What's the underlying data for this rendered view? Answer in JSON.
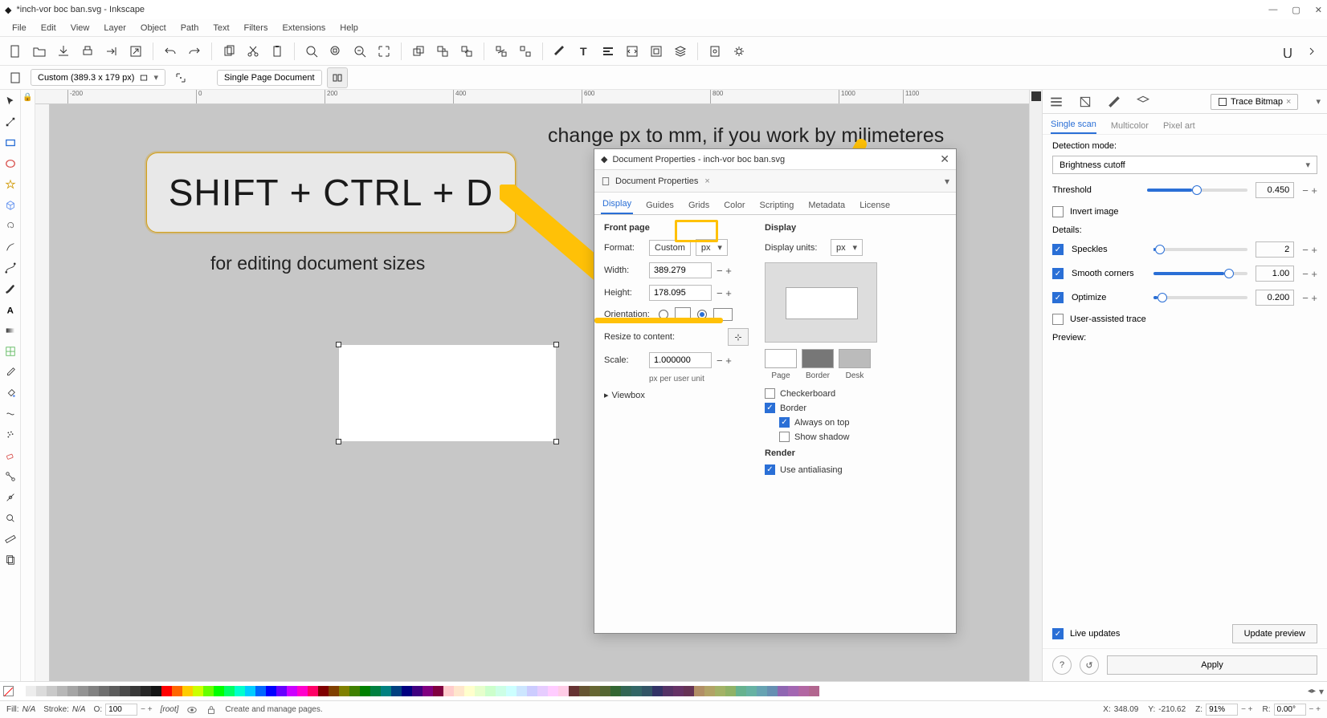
{
  "window": {
    "title": "*inch-vor boc ban.svg - Inkscape"
  },
  "menu": [
    "File",
    "Edit",
    "View",
    "Layer",
    "Object",
    "Path",
    "Text",
    "Filters",
    "Extensions",
    "Help"
  ],
  "doc_info": {
    "dimensions": "Custom (389.3 x 179 px)",
    "mode": "Single Page Document"
  },
  "annotations": {
    "shortcut": "SHIFT + CTRL + D",
    "subtitle": "for editing document sizes",
    "top_note": "change px to mm, if you work by milimeteres"
  },
  "dialog": {
    "title": "Document Properties - inch-vor boc ban.svg",
    "inner_tab": "Document Properties",
    "tabs": [
      "Display",
      "Guides",
      "Grids",
      "Color",
      "Scripting",
      "Metadata",
      "License"
    ],
    "active_tab": "Display",
    "front_page": {
      "heading": "Front page",
      "format_label": "Format:",
      "format_value": "Custom",
      "unit": "px",
      "width_label": "Width:",
      "width_value": "389.279",
      "height_label": "Height:",
      "height_value": "178.095",
      "orientation_label": "Orientation:",
      "resize_label": "Resize to content:",
      "scale_label": "Scale:",
      "scale_value": "1.000000",
      "scale_hint": "px per user unit",
      "viewbox_label": "Viewbox"
    },
    "display": {
      "heading": "Display",
      "units_label": "Display units:",
      "units_value": "px",
      "swatch_labels": [
        "Page",
        "Border",
        "Desk"
      ],
      "checkerboard": "Checkerboard",
      "border": "Border",
      "always_on_top": "Always on top",
      "show_shadow": "Show shadow",
      "render_heading": "Render",
      "antialiasing": "Use antialiasing"
    }
  },
  "trace_panel": {
    "tab_label": "Trace Bitmap",
    "sub_tabs": [
      "Single scan",
      "Multicolor",
      "Pixel art"
    ],
    "active_sub": "Single scan",
    "detection_label": "Detection mode:",
    "detection_value": "Brightness cutoff",
    "threshold_label": "Threshold",
    "threshold_value": "0.450",
    "invert_label": "Invert image",
    "details_label": "Details:",
    "speckles_label": "Speckles",
    "speckles_value": "2",
    "smooth_label": "Smooth corners",
    "smooth_value": "1.00",
    "optimize_label": "Optimize",
    "optimize_value": "0.200",
    "user_assisted_label": "User-assisted trace",
    "preview_label": "Preview:",
    "live_updates": "Live updates",
    "update_preview": "Update preview",
    "apply": "Apply"
  },
  "status": {
    "fill_label": "Fill:",
    "fill_value": "N/A",
    "stroke_label": "Stroke:",
    "stroke_value": "N/A",
    "opacity_label": "O:",
    "opacity_value": "100",
    "layer": "[root]",
    "hint": "Create and manage pages.",
    "x_label": "X:",
    "x_value": "348.09",
    "y_label": "Y:",
    "y_value": "-210.62",
    "z_label": "Z:",
    "z_value": "91%",
    "r_label": "R:",
    "r_value": "0.00°"
  },
  "ruler_ticks": [
    "-200",
    "0",
    "200",
    "400",
    "600",
    "800",
    "1000",
    "1100"
  ]
}
